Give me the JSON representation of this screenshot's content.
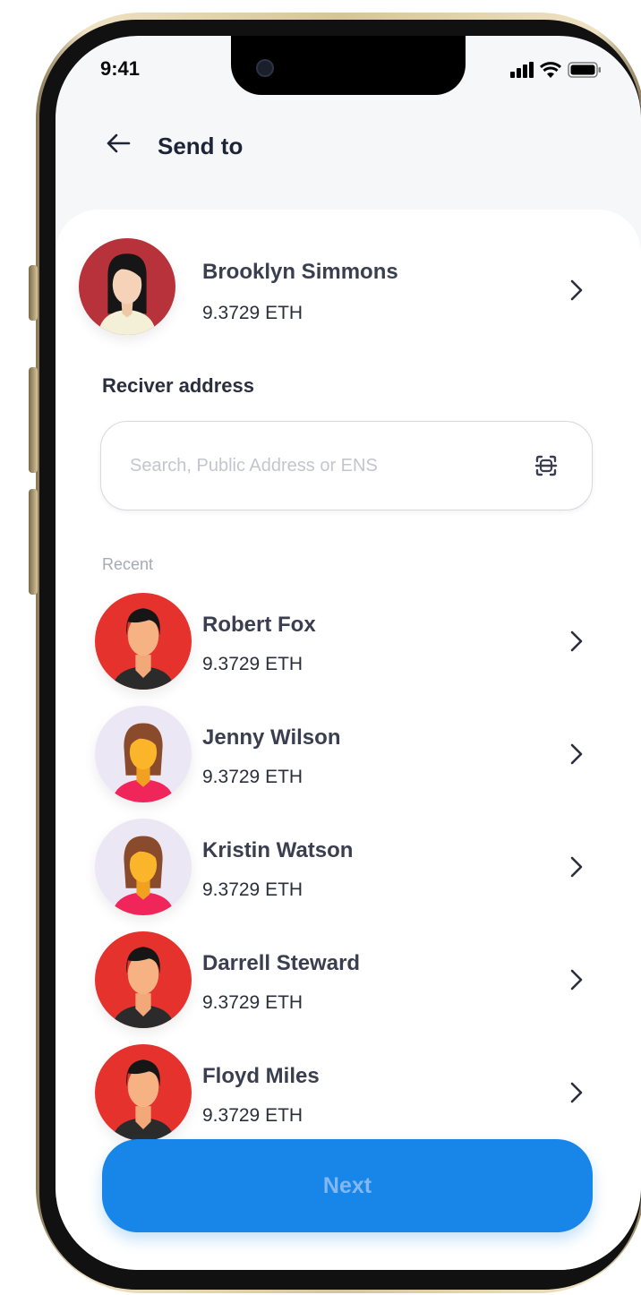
{
  "status_bar": {
    "time": "9:41"
  },
  "header": {
    "title": "Send to"
  },
  "selected_contact": {
    "name": "Brooklyn Simmons",
    "balance": "9.3729 ETH"
  },
  "receiver": {
    "label": "Reciver address",
    "placeholder": "Search, Public Address or ENS",
    "value": ""
  },
  "recent": {
    "label": "Recent",
    "contacts": [
      {
        "name": "Robert Fox",
        "balance": "9.3729 ETH"
      },
      {
        "name": "Jenny Wilson",
        "balance": "9.3729 ETH"
      },
      {
        "name": "Kristin Watson",
        "balance": "9.3729 ETH"
      },
      {
        "name": "Darrell Steward",
        "balance": "9.3729 ETH"
      },
      {
        "name": "Floyd Miles",
        "balance": "9.3729 ETH"
      }
    ]
  },
  "actions": {
    "next_label": "Next"
  },
  "icons": {
    "back": "arrow-left-icon",
    "chevron": "chevron-right-icon",
    "scan": "scan-qr-icon",
    "signal": "signal-icon",
    "wifi": "wifi-icon",
    "battery": "battery-icon"
  },
  "colors": {
    "primary": "#1786e8",
    "text_dark": "#1e2438",
    "avatar_red": "#e5322d",
    "avatar_lavender": "#ebe7f5"
  }
}
